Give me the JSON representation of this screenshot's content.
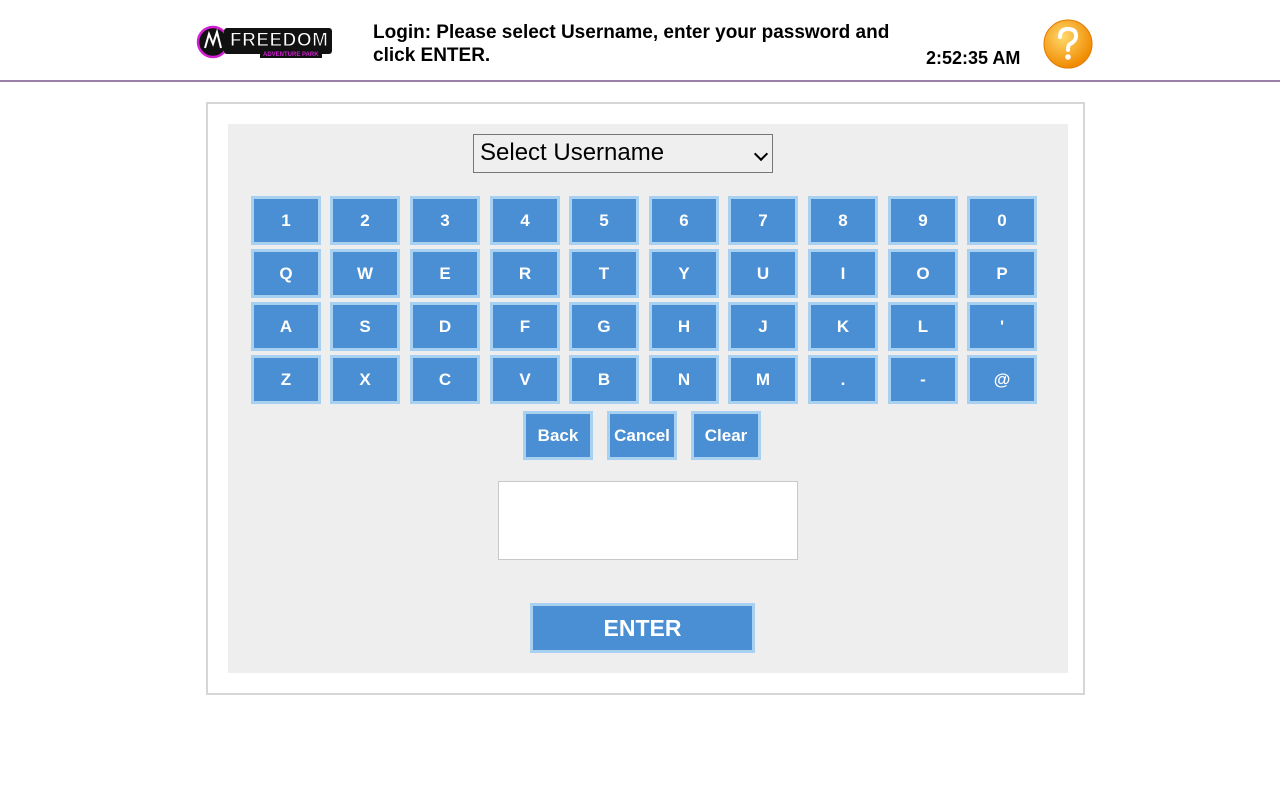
{
  "header": {
    "logo_text": "FREEDOM",
    "logo_subtext": "ADVENTURE PARK",
    "instruction": "Login: Please select Username, enter your password and click ENTER.",
    "clock": "2:52:35 AM",
    "help_icon": "question-mark-icon"
  },
  "login": {
    "username_select": {
      "selected": "Select Username"
    },
    "keyboard_rows": [
      [
        "1",
        "2",
        "3",
        "4",
        "5",
        "6",
        "7",
        "8",
        "9",
        "0"
      ],
      [
        "Q",
        "W",
        "E",
        "R",
        "T",
        "Y",
        "U",
        "I",
        "O",
        "P"
      ],
      [
        "A",
        "S",
        "D",
        "F",
        "G",
        "H",
        "J",
        "K",
        "L",
        "'"
      ],
      [
        "Z",
        "X",
        "C",
        "V",
        "B",
        "N",
        "M",
        ".",
        "-",
        "@"
      ]
    ],
    "actions": [
      "Back",
      "Cancel",
      "Clear"
    ],
    "password_value": "",
    "enter_label": "ENTER"
  },
  "colors": {
    "key_fill": "#4a8fd3",
    "key_border": "#a8d0f0",
    "panel_bg": "#eeeeee",
    "logo_accent": "#d21fd4",
    "help_icon_fill": "#f5a623"
  }
}
